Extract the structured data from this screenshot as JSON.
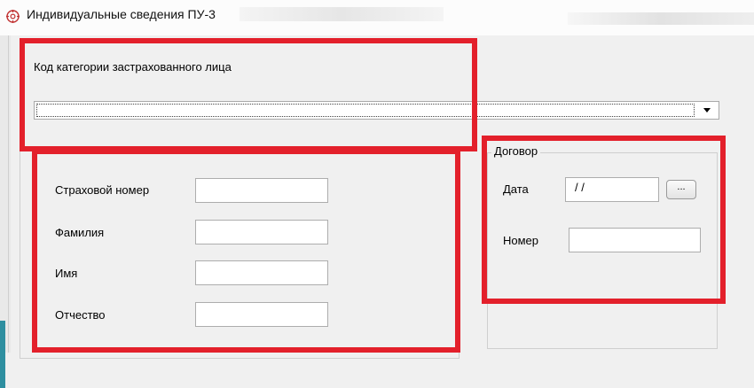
{
  "window": {
    "title": "Индивидуальные сведения ПУ-3",
    "icon": "gear-icon"
  },
  "category": {
    "label": "Код категории застрахованного лица",
    "selected": ""
  },
  "person": {
    "fields": [
      {
        "label": "Страховой номер",
        "value": ""
      },
      {
        "label": "Фамилия",
        "value": ""
      },
      {
        "label": "Имя",
        "value": ""
      },
      {
        "label": "Отчество",
        "value": ""
      }
    ]
  },
  "contract": {
    "title": "Договор",
    "date_label": "Дата",
    "date_value": "/ /",
    "browse_label": "...",
    "number_label": "Номер",
    "number_value": ""
  },
  "highlight_color": "#e3202b"
}
